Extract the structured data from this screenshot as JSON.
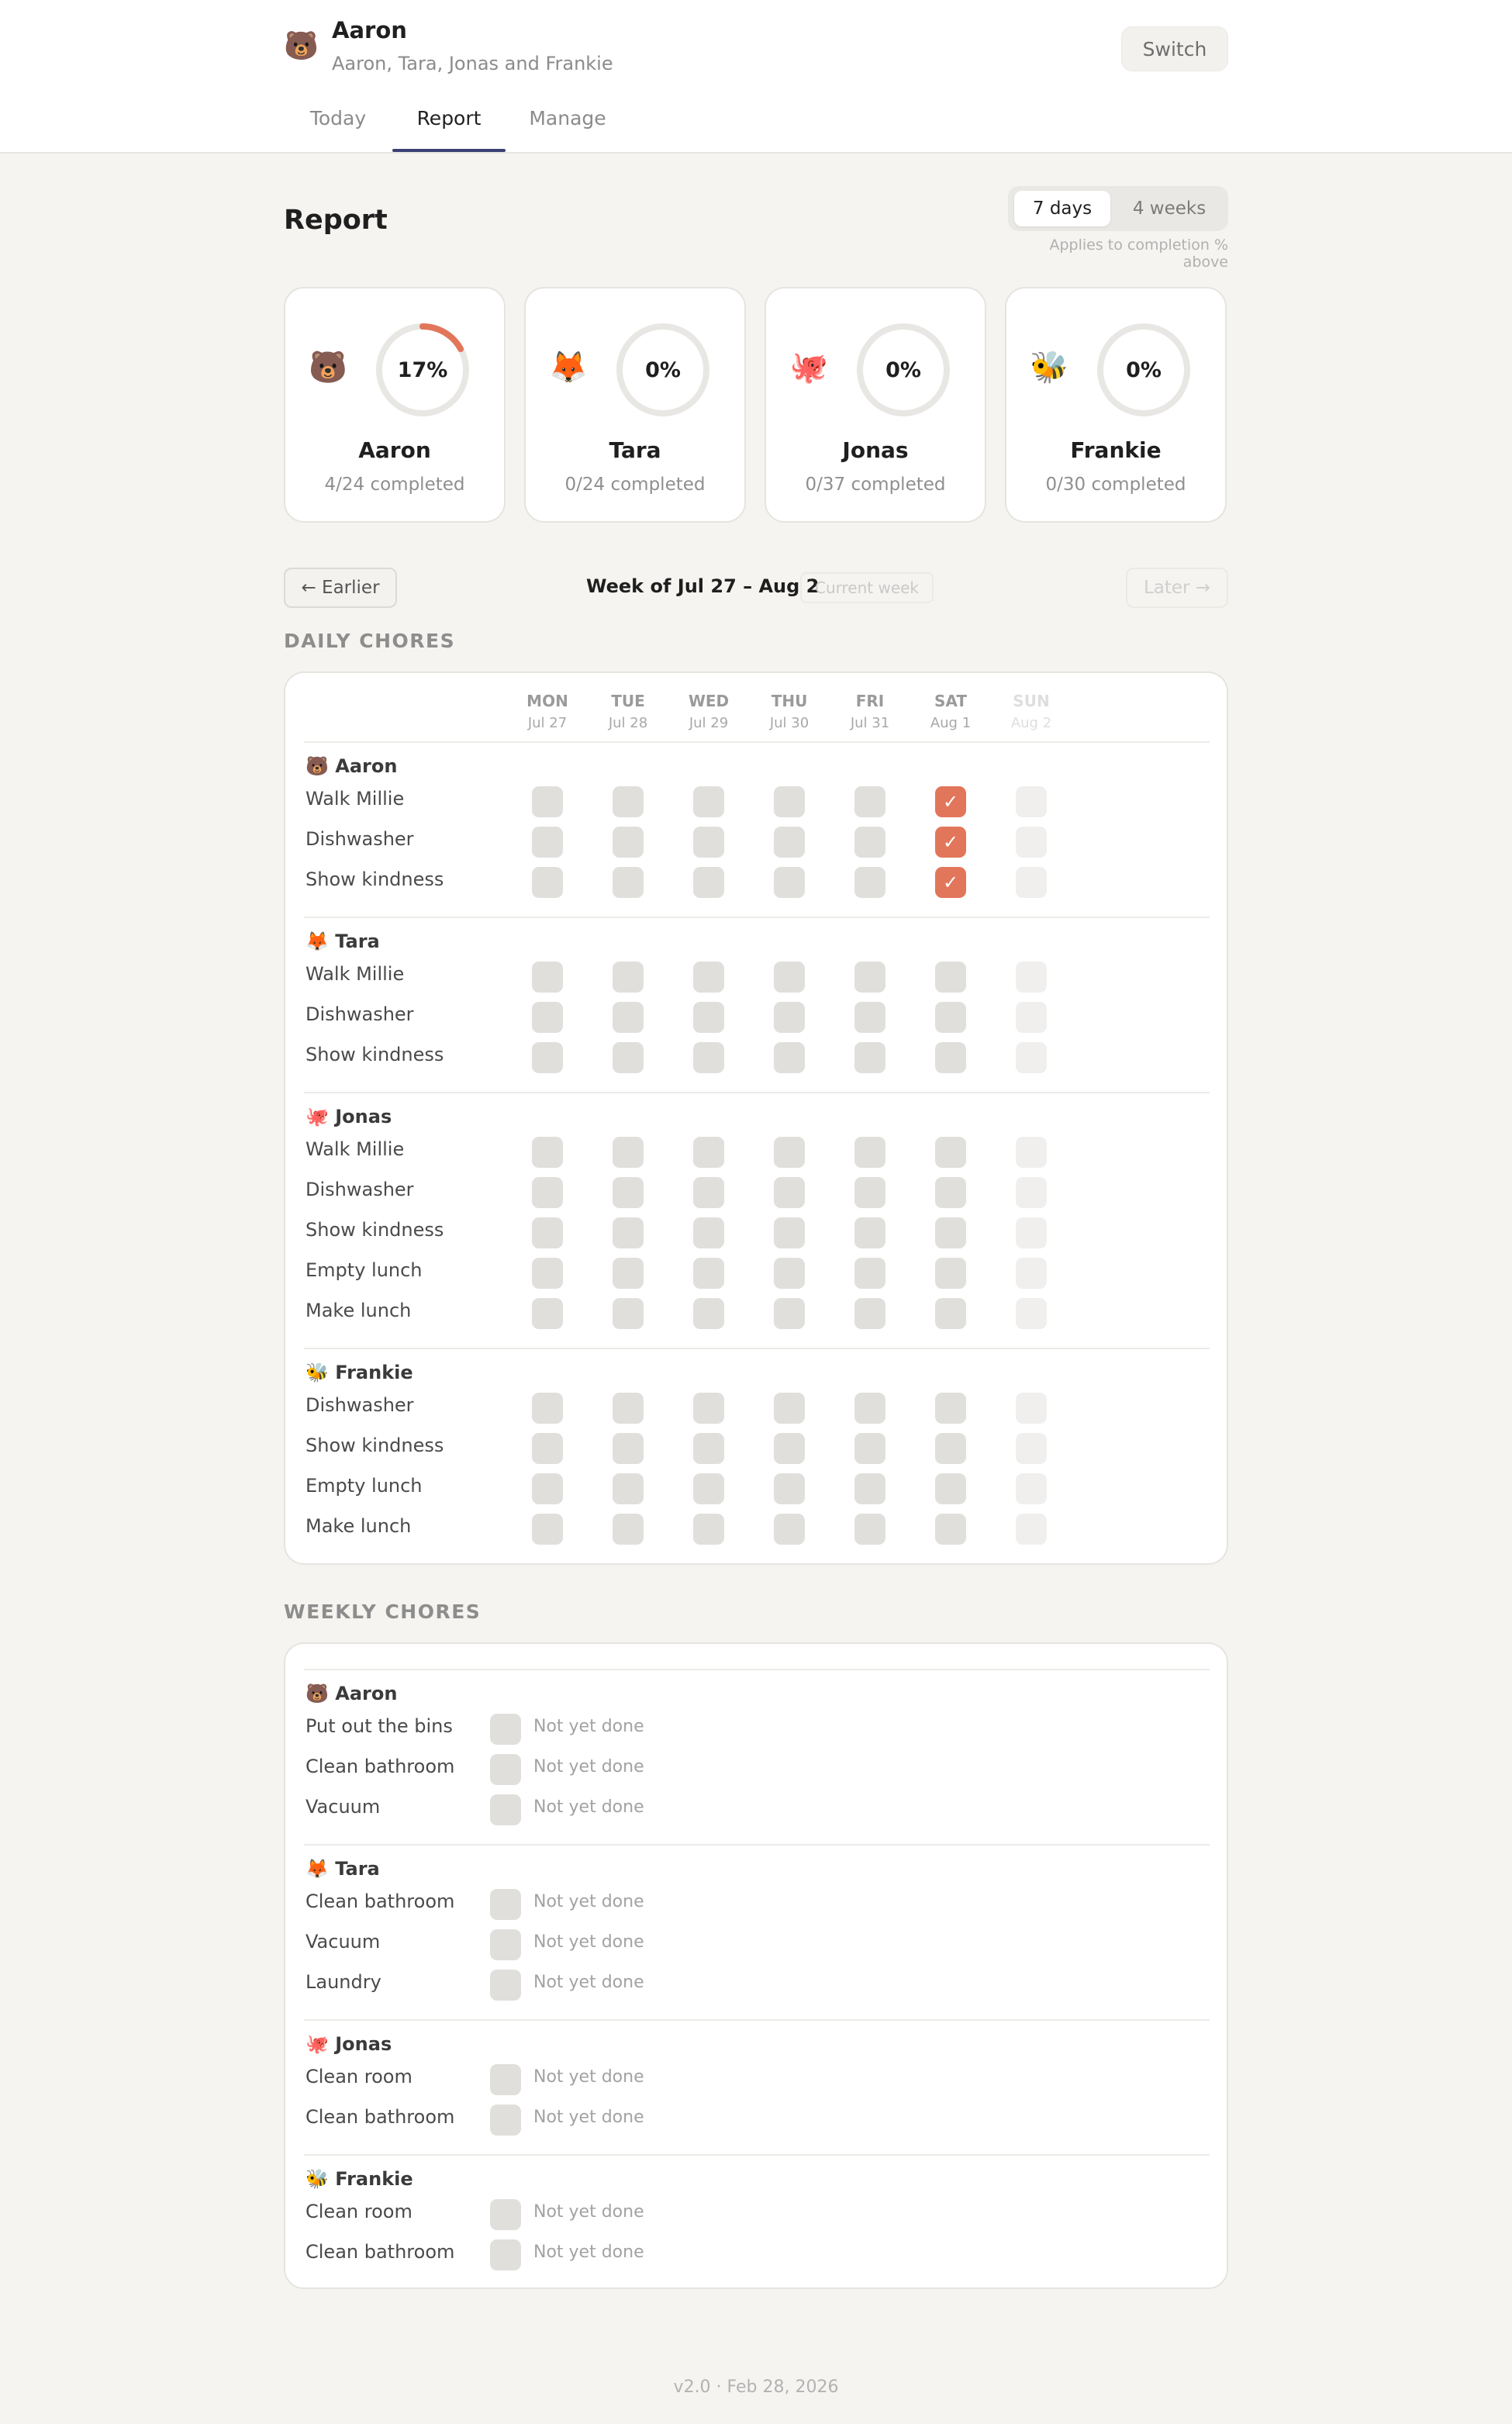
{
  "app": {
    "user_name": "Aaron",
    "user_emoji": "🐻",
    "household": "Aaron, Tara, Jonas and Frankie",
    "switch_label": "Switch"
  },
  "tabs": [
    {
      "label": "Today",
      "active": false
    },
    {
      "label": "Report",
      "active": true
    },
    {
      "label": "Manage",
      "active": false
    }
  ],
  "report": {
    "title": "Report",
    "range_options": [
      {
        "label": "7 days",
        "active": true
      },
      {
        "label": "4 weeks",
        "active": false
      }
    ],
    "range_note": "Applies to completion % above"
  },
  "accent_color": "#e2765b",
  "members": [
    {
      "name": "Aaron",
      "emoji": "🐻",
      "percent_label": "17%",
      "percent": 0.17,
      "count_label": "4/24 completed"
    },
    {
      "name": "Tara",
      "emoji": "🦊",
      "percent_label": "0%",
      "percent": 0,
      "count_label": "0/24 completed"
    },
    {
      "name": "Jonas",
      "emoji": "🐙",
      "percent_label": "0%",
      "percent": 0,
      "count_label": "0/37 completed"
    },
    {
      "name": "Frankie",
      "emoji": "🐝",
      "percent_label": "0%",
      "percent": 0,
      "count_label": "0/30 completed"
    }
  ],
  "week_nav": {
    "earlier": "← Earlier",
    "week_label": "Week of Jul 27 – Aug 2",
    "current_week": "Current week",
    "later": "Later →"
  },
  "daily": {
    "title": "DAILY CHORES",
    "days": [
      {
        "name": "MON",
        "date": "Jul 27",
        "future": false
      },
      {
        "name": "TUE",
        "date": "Jul 28",
        "future": false
      },
      {
        "name": "WED",
        "date": "Jul 29",
        "future": false
      },
      {
        "name": "THU",
        "date": "Jul 30",
        "future": false
      },
      {
        "name": "FRI",
        "date": "Jul 31",
        "future": false
      },
      {
        "name": "SAT",
        "date": "Aug 1",
        "future": false
      },
      {
        "name": "SUN",
        "date": "Aug 2",
        "future": true
      }
    ],
    "done_mark": "✓",
    "groups": [
      {
        "label": "🐻 Aaron",
        "chores": [
          {
            "name": "Walk Millie",
            "done": [
              false,
              false,
              false,
              false,
              false,
              true,
              false
            ]
          },
          {
            "name": "Dishwasher",
            "done": [
              false,
              false,
              false,
              false,
              false,
              true,
              false
            ]
          },
          {
            "name": "Show kindness",
            "done": [
              false,
              false,
              false,
              false,
              false,
              true,
              false
            ]
          }
        ]
      },
      {
        "label": "🦊 Tara",
        "chores": [
          {
            "name": "Walk Millie",
            "done": [
              false,
              false,
              false,
              false,
              false,
              false,
              false
            ]
          },
          {
            "name": "Dishwasher",
            "done": [
              false,
              false,
              false,
              false,
              false,
              false,
              false
            ]
          },
          {
            "name": "Show kindness",
            "done": [
              false,
              false,
              false,
              false,
              false,
              false,
              false
            ]
          }
        ]
      },
      {
        "label": "🐙 Jonas",
        "chores": [
          {
            "name": "Walk Millie",
            "done": [
              false,
              false,
              false,
              false,
              false,
              false,
              false
            ]
          },
          {
            "name": "Dishwasher",
            "done": [
              false,
              false,
              false,
              false,
              false,
              false,
              false
            ]
          },
          {
            "name": "Show kindness",
            "done": [
              false,
              false,
              false,
              false,
              false,
              false,
              false
            ]
          },
          {
            "name": "Empty lunch",
            "done": [
              false,
              false,
              false,
              false,
              false,
              false,
              false
            ]
          },
          {
            "name": "Make lunch",
            "done": [
              false,
              false,
              false,
              false,
              false,
              false,
              false
            ]
          }
        ]
      },
      {
        "label": "🐝 Frankie",
        "chores": [
          {
            "name": "Dishwasher",
            "done": [
              false,
              false,
              false,
              false,
              false,
              false,
              false
            ]
          },
          {
            "name": "Show kindness",
            "done": [
              false,
              false,
              false,
              false,
              false,
              false,
              false
            ]
          },
          {
            "name": "Empty lunch",
            "done": [
              false,
              false,
              false,
              false,
              false,
              false,
              false
            ]
          },
          {
            "name": "Make lunch",
            "done": [
              false,
              false,
              false,
              false,
              false,
              false,
              false
            ]
          }
        ]
      }
    ]
  },
  "weekly": {
    "title": "WEEKLY CHORES",
    "groups": [
      {
        "label": "🐻 Aaron",
        "chores": [
          {
            "name": "Put out the bins",
            "status": "Not yet done"
          },
          {
            "name": "Clean bathroom",
            "status": "Not yet done"
          },
          {
            "name": "Vacuum",
            "status": "Not yet done"
          }
        ]
      },
      {
        "label": "🦊 Tara",
        "chores": [
          {
            "name": "Clean bathroom",
            "status": "Not yet done"
          },
          {
            "name": "Vacuum",
            "status": "Not yet done"
          },
          {
            "name": "Laundry",
            "status": "Not yet done"
          }
        ]
      },
      {
        "label": "🐙 Jonas",
        "chores": [
          {
            "name": "Clean room",
            "status": "Not yet done"
          },
          {
            "name": "Clean bathroom",
            "status": "Not yet done"
          }
        ]
      },
      {
        "label": "🐝 Frankie",
        "chores": [
          {
            "name": "Clean room",
            "status": "Not yet done"
          },
          {
            "name": "Clean bathroom",
            "status": "Not yet done"
          }
        ]
      }
    ]
  },
  "footer": "v2.0 · Feb 28, 2026"
}
